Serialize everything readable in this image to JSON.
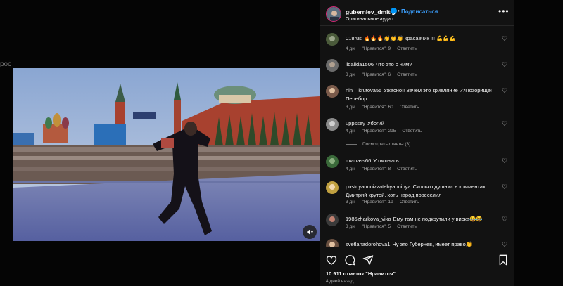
{
  "background": {
    "fragment_text": "рос"
  },
  "post": {
    "owner": "guberniev_dmitry",
    "follow_label": "Подписаться",
    "separator": "•",
    "audio_label": "Оригинальное аудио",
    "more_label": "•••"
  },
  "comments": [
    {
      "user": "018rus",
      "text": "🔥🔥🔥👏👏👏 красавчик !!! 💪💪💪",
      "age": "4 дн.",
      "likes": "\"Нравится\": 9",
      "reply": "Ответить"
    },
    {
      "user": "lidalida1506",
      "text": "Что это с ним?",
      "age": "3 дн.",
      "likes": "\"Нравится\": 6",
      "reply": "Ответить"
    },
    {
      "user": "nin__krutova55",
      "text": "Ужасно!! Зачем это кривляние ??Позорище! Перебор.",
      "age": "3 дн.",
      "likes": "\"Нравится\": 60",
      "reply": "Ответить"
    },
    {
      "user": "uppssey",
      "text": "Убогий",
      "age": "4 дн.",
      "likes": "\"Нравится\": 295",
      "reply": "Ответить",
      "replies": "Посмотреть ответы (3)"
    },
    {
      "user": "mvmass66",
      "text": "Угомонись...",
      "age": "4 дн.",
      "likes": "\"Нравится\": 8",
      "reply": "Ответить"
    },
    {
      "user": "postoyannoizzatebyahuinya",
      "text": "Сколько душнил в комментах. Дмитрий крутой, хоть народ повеселил",
      "age": "3 дн.",
      "likes": "\"Нравится\": 19",
      "reply": "Ответить"
    },
    {
      "user": "1985zharkova_vika",
      "text": "Ему там не подкрутили у виска😂😂",
      "age": "3 дн.",
      "likes": "\"Нравится\": 5",
      "reply": "Ответить"
    },
    {
      "user": "svetlanadorohova1",
      "text": "Ну это Губернев, имеет право👏",
      "age": "",
      "likes": "",
      "reply": ""
    }
  ],
  "footer": {
    "likes_count": "10 911 отметок \"Нравится\"",
    "date": "4 дней назад"
  },
  "icons": {
    "heart": "heart-icon",
    "comment": "comment-icon",
    "share": "share-icon",
    "save": "bookmark-icon",
    "mute": "muted-speaker-icon",
    "verified": "verified-badge-icon"
  },
  "colors": {
    "follow": "#3a9bf7",
    "verified": "#0095f6",
    "panel": "#121212"
  }
}
